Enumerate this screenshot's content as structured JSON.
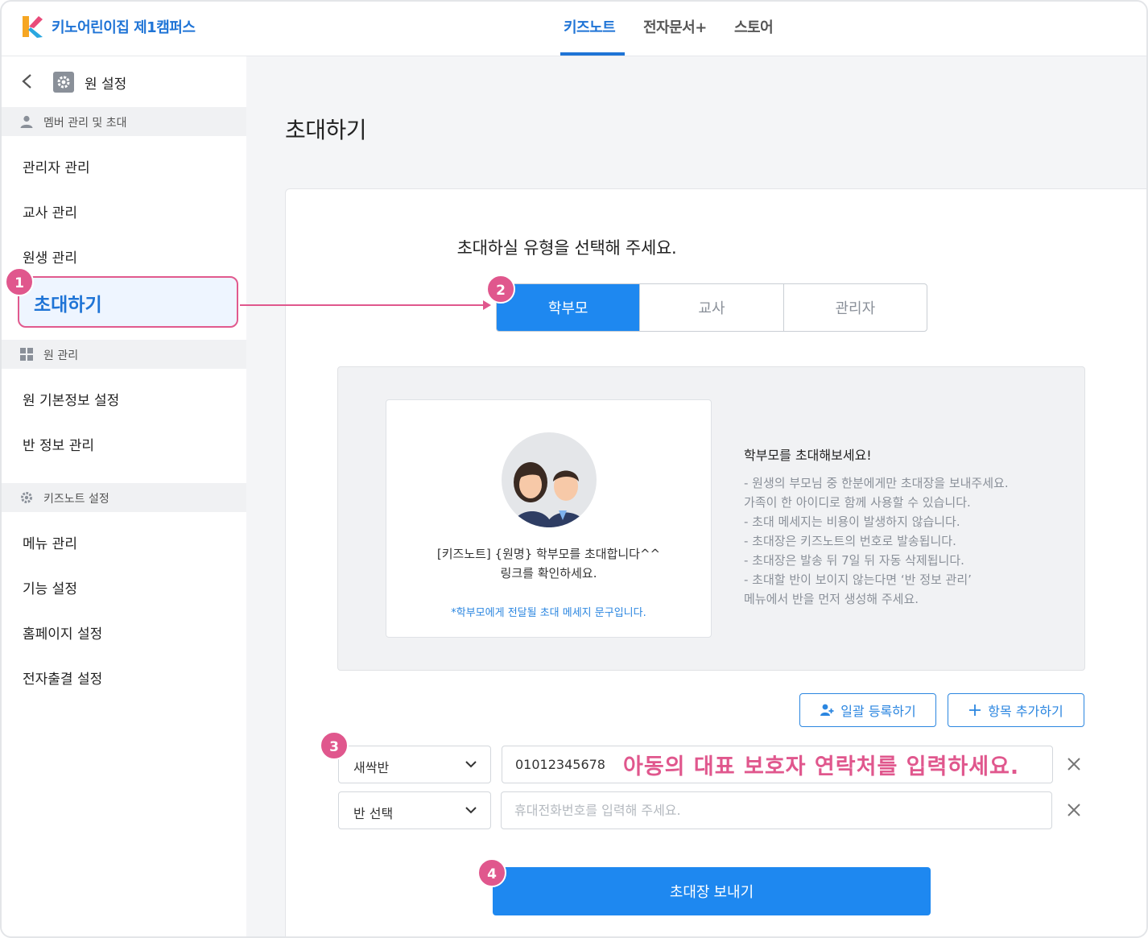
{
  "header": {
    "org_name": "키노어린이집 제1캠퍼스",
    "tabs": [
      {
        "label": "키즈노트",
        "active": true
      },
      {
        "label": "전자문서+",
        "active": false
      },
      {
        "label": "스토어",
        "active": false
      }
    ],
    "accent_color": "#1f74d6"
  },
  "sidebar": {
    "title": "원 설정",
    "sections": [
      {
        "label": "멤버 관리 및 초대",
        "icon": "person-icon",
        "items": [
          "관리자 관리",
          "교사 관리",
          "원생 관리",
          "초대하기"
        ]
      },
      {
        "label": "원 관리",
        "icon": "grid-icon",
        "items": [
          "원 기본정보 설정",
          "반 정보 관리"
        ]
      },
      {
        "label": "키즈노트 설정",
        "icon": "gear-icon",
        "items": [
          "메뉴 관리",
          "기능 설정",
          "홈페이지 설정",
          "전자출결 설정"
        ]
      }
    ],
    "active_item": "초대하기"
  },
  "main": {
    "page_title": "초대하기",
    "question": "초대하실 유형을 선택해 주세요.",
    "types": [
      "학부모",
      "교사",
      "관리자"
    ],
    "selected_type": "학부모",
    "message_preview": {
      "line1": "[키즈노트] {원명} 학부모를 초대합니다^^",
      "line2": "링크를 확인하세요.",
      "note": "*학부모에게 전달될 초대 메세지 문구입니다."
    },
    "info": {
      "title": "학부모를 초대해보세요!",
      "lines": [
        "- 원생의 부모님 중 한분에게만 초대장을 보내주세요.",
        "   가족이 한 아이디로 함께 사용할 수 있습니다.",
        "- 초대 메세지는 비용이 발생하지 않습니다.",
        "- 초대장은 키즈노트의 번호로 발송됩니다.",
        "- 초대장은 발송 뒤 7일 뒤 자동 삭제됩니다.",
        "- 초대할 반이 보이지 않는다면 ‘반 정보 관리’",
        "   메뉴에서 반을 먼저 생성해 주세요."
      ]
    },
    "bulk_button": "일괄 등록하기",
    "add_button": "항목 추가하기",
    "rows": [
      {
        "class": "새싹반",
        "phone": "01012345678",
        "placeholder": ""
      },
      {
        "class": "반 선택",
        "phone": "",
        "placeholder": "휴대전화번호를 입력해 주세요."
      }
    ],
    "annotation": "아동의 대표 보호자 연락처를 입력하세요.",
    "send_button": "초대장 보내기"
  },
  "badges": [
    "1",
    "2",
    "3",
    "4"
  ],
  "highlight_color": "#e0578d"
}
